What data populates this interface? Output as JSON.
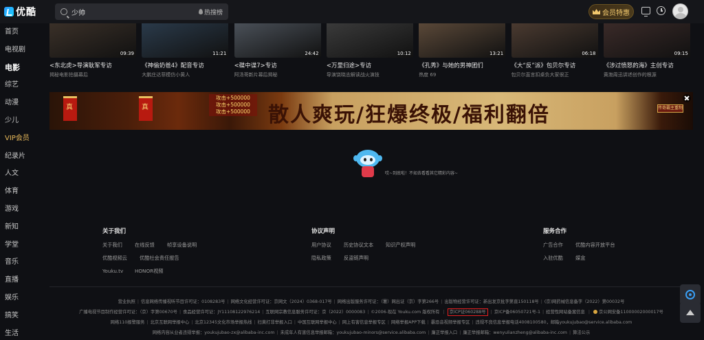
{
  "app": {
    "logo_text": "优酷"
  },
  "search": {
    "value": "少帅",
    "hot_label": "热搜榜"
  },
  "header": {
    "vip_label": "会员特惠"
  },
  "sidebar": {
    "items": [
      {
        "label": "首页"
      },
      {
        "label": "电视剧"
      },
      {
        "label": "电影"
      },
      {
        "label": "综艺"
      },
      {
        "label": "动漫"
      },
      {
        "label": "少儿"
      },
      {
        "label": "VIP会员"
      },
      {
        "label": "纪录片"
      },
      {
        "label": "人文"
      },
      {
        "label": "体育"
      },
      {
        "label": "游戏"
      },
      {
        "label": "新知"
      },
      {
        "label": "学堂"
      },
      {
        "label": "音乐"
      },
      {
        "label": "直播"
      },
      {
        "label": "娱乐"
      },
      {
        "label": "搞笑"
      },
      {
        "label": "生活"
      }
    ]
  },
  "videos": [
    {
      "title": "<东北虎>导演耿军专访",
      "sub": "揭秘电影拍摄幕后",
      "duration": "09:39",
      "color": "#3a3028"
    },
    {
      "title": "《神偷奶爸4》配音专访",
      "sub": "大鹏庄达菲模仿小黄人",
      "duration": "11:21",
      "color": "#2a3a4a"
    },
    {
      "title": "<碟中谍7>专访",
      "sub": "阿汤哥新片幕后揭秘",
      "duration": "24:42",
      "color": "#4a5058"
    },
    {
      "title": "<万里归途>专访",
      "sub": "导演饶晓志解读战火演技",
      "duration": "10:12",
      "color": "#3a3a3a"
    },
    {
      "title": "《孔秀》与她的男神团们",
      "sub": "热度 69",
      "duration": "13:21",
      "color": "#5a4838"
    },
    {
      "title": "《大“反”派》包贝尔专访",
      "sub": "包贝尔直言扣桌负大家很正",
      "duration": "06:18",
      "color": "#4a3a30"
    },
    {
      "title": "《涉过愤怒的海》主创专访",
      "sub": "黄渤周迅讲述创作的根源",
      "duration": "09:15",
      "color": "#3a2a28"
    }
  ],
  "banner": {
    "headline": "散人爽玩/狂爆终极/福利翻倍",
    "flag_text": "真",
    "price_lines": [
      "攻击+500000",
      "攻击+500000",
      "攻击+500000"
    ],
    "badge": "传奇霸主重制"
  },
  "empty_state": {
    "text": "哎~到底啦！不如去看看其它精彩内容~"
  },
  "footer": {
    "col1": {
      "title": "关于我们",
      "links": [
        "关于我们",
        "在线反馈",
        "帧享设备说明",
        "优酷视频云",
        "优酷社会责任报告",
        "Youku.tv",
        "HONOR视频"
      ]
    },
    "col2": {
      "title": "协议声明",
      "links": [
        "用户协议",
        "历史协议文本",
        "知识产权声明",
        "隐私政策",
        "反盗链声明"
      ]
    },
    "col3": {
      "title": "服务合作",
      "links": [
        "广告合作",
        "优酷内容开放平台",
        "入驻优酷",
        "媒盒"
      ]
    }
  },
  "legal": {
    "line1": [
      "营业执照",
      "信息网络传播视听节目许可证：0108283号",
      "网络文化经营许可证：京网文（2024）0368-017号",
      "网络出版服务许可证：（署）网出证（京）字第266号",
      "出版物经营许可证：新出发京批字第直150118号",
      "(京)网药械信息备字（2022）第00032号"
    ],
    "line2_a": [
      "广播电视节目制作经营许可证：（京）字第00670号",
      "食品经营许可证：JY11108122976214",
      "互联网宗教信息服务许可证：京（2022）0000083",
      "©2006-现在 Youku.com 版权所有"
    ],
    "line2_icp": "京ICP证060288号",
    "line2_b": [
      "京ICP备06050721号-1",
      "经营性网站备案信息"
    ],
    "line2_police": "京公网安备11000002000017号",
    "line3": [
      "网络110报警服务",
      "北京互联网举报中心",
      "北京12345文化市场举报热线",
      "扫黄打非举报入口",
      "中国互联网举报中心",
      "网上有害信息举报专区",
      "网络举报APP下载",
      "暴恐音视频举报专区",
      "违规不良信息举报电话4008100580，邮箱youkujubao@service.alibaba.com"
    ],
    "line4": [
      "网络内容从业者违规举报：youkujubao-zx@alibaba-inc.com",
      "未成年人有害信息举报邮箱：youkujubao-minors@service.alibaba.com",
      "廉正举报入口",
      "廉正举报邮箱：wenyulianzheng@alibaba-inc.com",
      "算法公示"
    ]
  }
}
